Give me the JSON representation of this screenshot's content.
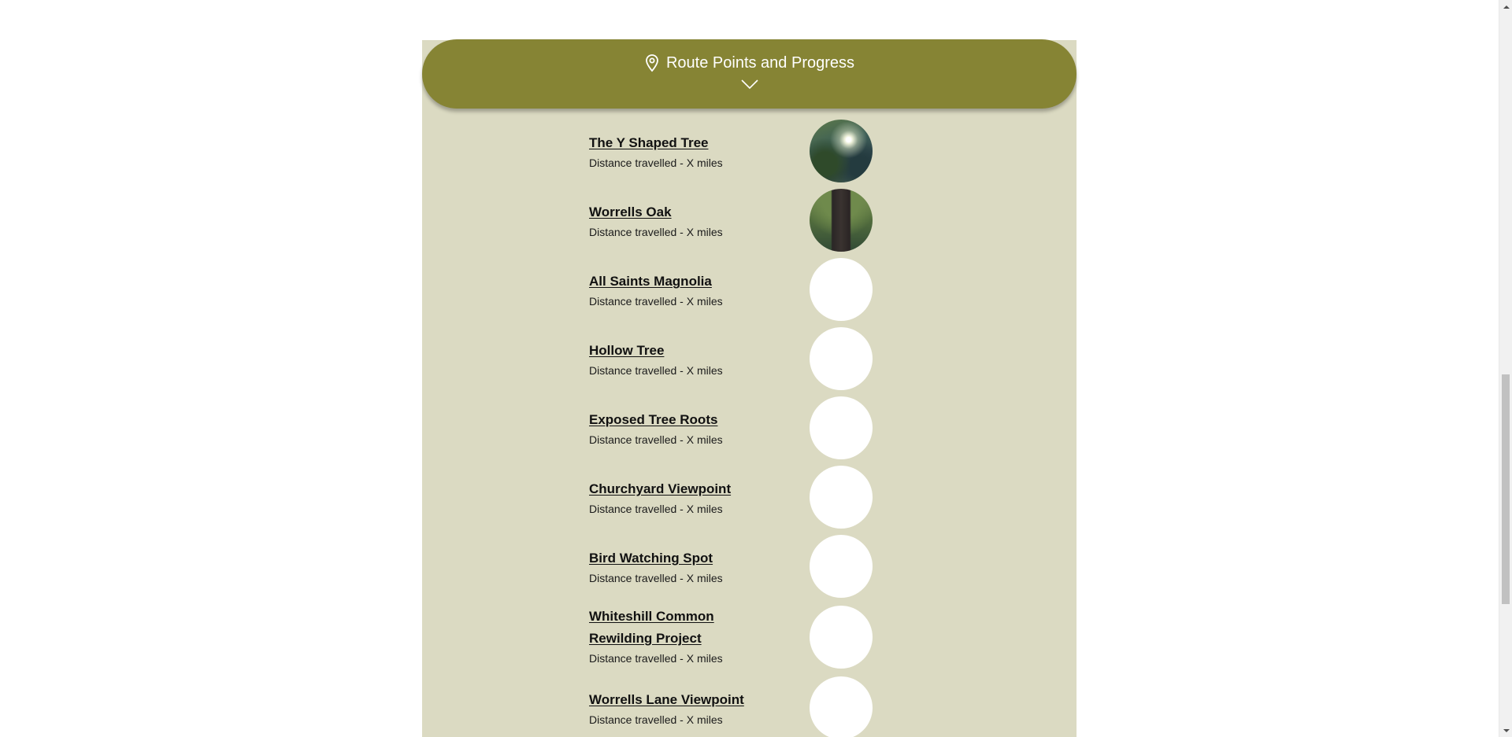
{
  "header": {
    "title": "Route Points and Progress",
    "icon": "map-pin-icon",
    "toggle_icon": "chevron-down-icon",
    "color": "#868434"
  },
  "panel": {
    "background_color": "#dbdac2"
  },
  "route_points": [
    {
      "name": "The Y Shaped Tree",
      "distance": "Distance travelled - X miles",
      "thumbnail": "tree-photo"
    },
    {
      "name": "Worrells Oak",
      "distance": "Distance travelled - X miles",
      "thumbnail": "oak-photo"
    },
    {
      "name": "All Saints Magnolia",
      "distance": "Distance travelled - X miles",
      "thumbnail": "empty"
    },
    {
      "name": "Hollow Tree",
      "distance": "Distance travelled - X miles",
      "thumbnail": "empty"
    },
    {
      "name": "Exposed Tree Roots",
      "distance": "Distance travelled - X miles",
      "thumbnail": "empty"
    },
    {
      "name": "Churchyard Viewpoint",
      "distance": "Distance travelled - X miles",
      "thumbnail": "empty"
    },
    {
      "name": "Bird Watching Spot",
      "distance": "Distance travelled - X miles",
      "thumbnail": "empty"
    },
    {
      "name": "Whiteshill Common Rewilding Project",
      "distance": "Distance travelled - X miles",
      "thumbnail": "empty"
    },
    {
      "name": "Worrells Lane Viewpoint",
      "distance": "Distance travelled - X miles",
      "thumbnail": "empty"
    }
  ]
}
